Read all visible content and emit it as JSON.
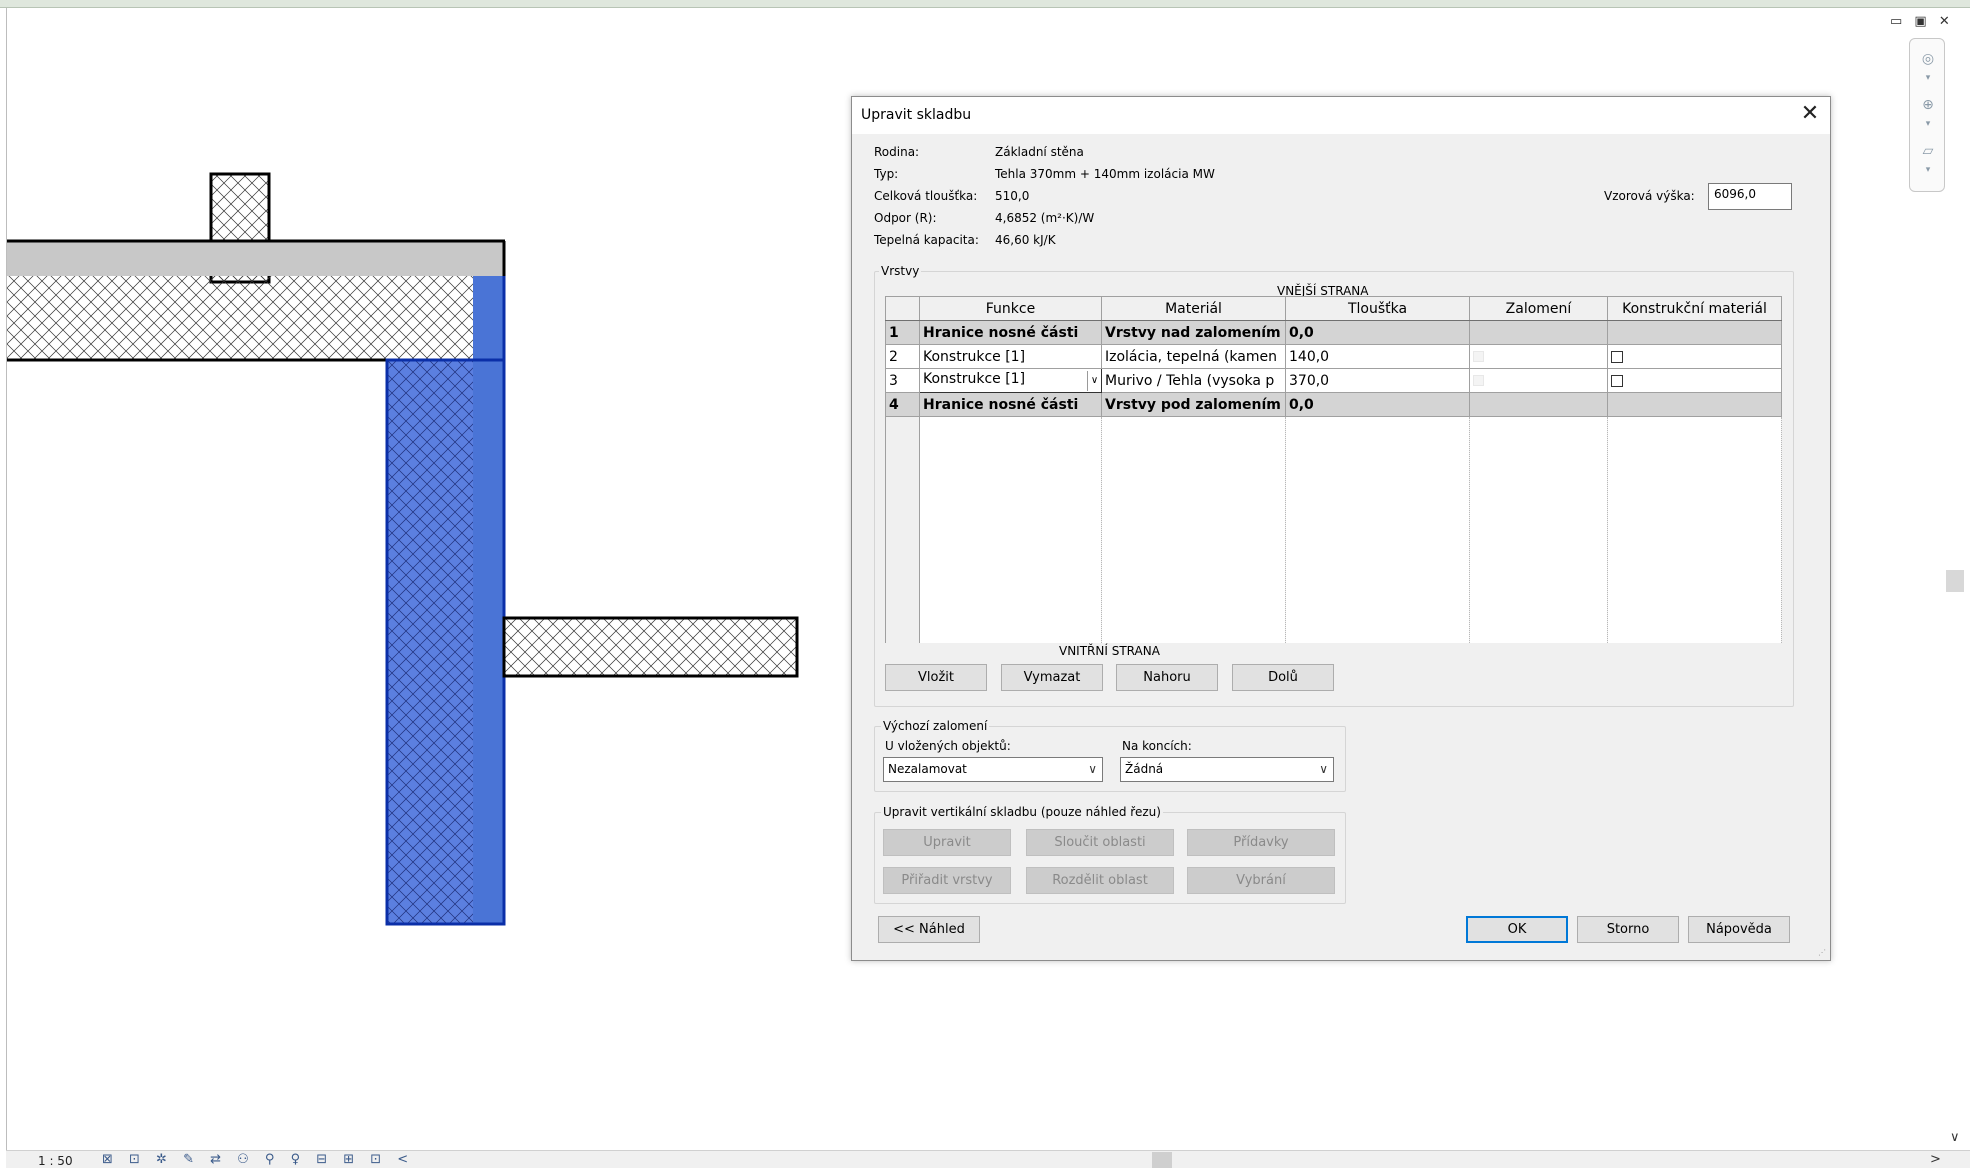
{
  "canvas": {
    "window_controls": "▭ ▣ ✕",
    "scale": "1 : 50",
    "status_icons": "⊠ ⊡ ✲ ✎ ⇄ ⚇ ⚲ ♀ ⊟ ⊞ ⊡ <"
  },
  "dialog": {
    "title": "Upravit skladbu",
    "close": "✕",
    "info": {
      "family_label": "Rodina:",
      "family_value": "Základní stěna",
      "type_label": "Typ:",
      "type_value": "Tehla 370mm + 140mm izolácia MW",
      "thickness_label": "Celková tloušťka:",
      "thickness_value": "510,0",
      "resistance_label": "Odpor (R):",
      "resistance_value": "4,6852 (m²·K)/W",
      "capacity_label": "Tepelná kapacita:",
      "capacity_value": "46,60 kJ/K",
      "sample_height_label": "Vzorová výška:",
      "sample_height_value": "6096,0"
    },
    "layers": {
      "group_title": "Vrstvy",
      "exterior": "VNĚJŠÍ STRANA",
      "interior": "VNITŘNÍ STRANA",
      "headers": [
        "",
        "Funkce",
        "Materiál",
        "Tloušťka",
        "Zalomení",
        "Konstrukční materiál"
      ],
      "rows": [
        {
          "num": "1",
          "function": "Hranice nosné části",
          "material": "Vrstvy nad zalomením",
          "thickness": "0,0"
        },
        {
          "num": "2",
          "function": "Konstrukce [1]",
          "material": "Izolácia, tepelná (kamen",
          "thickness": "140,0"
        },
        {
          "num": "3",
          "function": "Konstrukce [1]",
          "material": "Murivo / Tehla (vysoka  p",
          "thickness": "370,0"
        },
        {
          "num": "4",
          "function": "Hranice nosné části",
          "material": "Vrstvy pod zalomením",
          "thickness": "0,0"
        }
      ],
      "buttons": {
        "insert": "Vložit",
        "delete": "Vymazat",
        "up": "Nahoru",
        "down": "Dolů"
      }
    },
    "wrapping": {
      "group_title": "Výchozí zalomení",
      "inserts_label": "U vložených objektů:",
      "inserts_value": "Nezalamovat",
      "ends_label": "Na koncích:",
      "ends_value": "Žádná"
    },
    "vertical": {
      "group_title": "Upravit vertikální skladbu (pouze náhled řezu)",
      "modify": "Upravit",
      "merge": "Sloučit oblasti",
      "sweeps": "Přídavky",
      "assign": "Přiřadit vrstvy",
      "split": "Rozdělit oblast",
      "reveals": "Vybrání"
    },
    "footer": {
      "preview": "<< Náhled",
      "ok": "OK",
      "cancel": "Storno",
      "help": "Nápověda"
    }
  },
  "colors": {
    "wall_fill": "#4a74d6",
    "wall_hatch": "#6f8fe0",
    "slab_gray": "#c8c8c8",
    "default_button_border": "#0078d7"
  }
}
